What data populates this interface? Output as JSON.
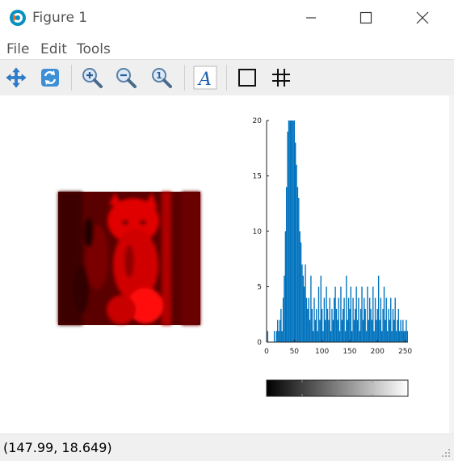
{
  "window": {
    "title": "Figure 1",
    "minimize": "—",
    "maximize": "☐",
    "close": "✕"
  },
  "menu": {
    "items": [
      "File",
      "Edit",
      "Tools"
    ]
  },
  "toolbar": {
    "tools": [
      {
        "name": "pan-icon",
        "label": "Pan"
      },
      {
        "name": "rotate-icon",
        "label": "Rotate"
      },
      {
        "name": "zoom-in-icon",
        "label": "Zoom In"
      },
      {
        "name": "zoom-out-icon",
        "label": "Zoom Out"
      },
      {
        "name": "zoom-reset-icon",
        "label": "Reset zoom"
      },
      {
        "name": "text-insert-icon",
        "label": "A"
      },
      {
        "name": "axes-box-icon",
        "label": "Toggle axes box"
      },
      {
        "name": "grid-icon",
        "label": "#"
      }
    ]
  },
  "status": {
    "coordinates": "(147.99, 18.649)"
  },
  "chart_data": {
    "type": "bar",
    "title": "",
    "xlabel": "",
    "ylabel": "",
    "xlim": [
      0,
      255
    ],
    "ylim": [
      0,
      20
    ],
    "xticks": [
      0,
      50,
      100,
      150,
      200,
      250
    ],
    "yticks": [
      0,
      5,
      10,
      15,
      20
    ],
    "color": "#0072BD",
    "grid": false,
    "x": [
      2,
      14,
      18,
      20,
      22,
      24,
      26,
      28,
      30,
      32,
      34,
      36,
      38,
      40,
      42,
      44,
      46,
      48,
      50,
      52,
      54,
      56,
      58,
      60,
      62,
      64,
      66,
      68,
      70,
      72,
      74,
      76,
      78,
      80,
      82,
      84,
      86,
      88,
      90,
      92,
      94,
      96,
      98,
      100,
      102,
      104,
      106,
      108,
      110,
      112,
      114,
      116,
      118,
      120,
      122,
      124,
      126,
      128,
      130,
      132,
      134,
      136,
      138,
      140,
      142,
      144,
      146,
      148,
      150,
      152,
      154,
      156,
      158,
      160,
      162,
      164,
      166,
      168,
      170,
      172,
      174,
      176,
      178,
      180,
      182,
      184,
      186,
      188,
      190,
      192,
      194,
      196,
      198,
      200,
      202,
      204,
      206,
      208,
      210,
      212,
      214,
      216,
      218,
      220,
      222,
      224,
      226,
      228,
      230,
      232,
      234,
      236,
      238,
      240,
      242,
      244,
      246,
      248,
      250,
      252,
      254
    ],
    "values": [
      1,
      1,
      1,
      2,
      1,
      2,
      3,
      1,
      4,
      6,
      10,
      14,
      19,
      20,
      20,
      20,
      20,
      20,
      20,
      18,
      16,
      14,
      13,
      10,
      9,
      7,
      6,
      5,
      7,
      4,
      3,
      4,
      2,
      6,
      3,
      1,
      4,
      2,
      3,
      1,
      5,
      2,
      6,
      3,
      1,
      4,
      2,
      5,
      3,
      2,
      4,
      1,
      3,
      2,
      4,
      5,
      3,
      2,
      4,
      1,
      5,
      2,
      3,
      4,
      1,
      6,
      2,
      4,
      3,
      5,
      1,
      4,
      2,
      3,
      5,
      2,
      4,
      1,
      3,
      5,
      2,
      4,
      3,
      1,
      5,
      2,
      4,
      3,
      2,
      5,
      1,
      4,
      2,
      3,
      6,
      2,
      4,
      1,
      3,
      5,
      2,
      4,
      1,
      3,
      2,
      4,
      1,
      3,
      2,
      4,
      1,
      2,
      3,
      1,
      2,
      1,
      2,
      1,
      1,
      2,
      1
    ],
    "colorbar": {
      "min_color": "#000000",
      "max_color": "#ffffff"
    }
  }
}
